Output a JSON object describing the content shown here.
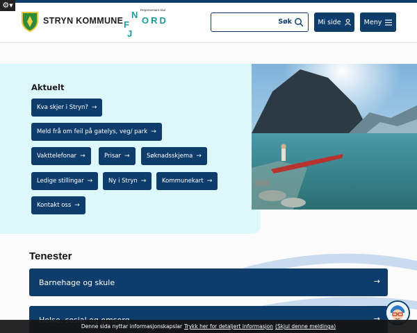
{
  "colors": {
    "primary": "#0f3d6b",
    "accent": "#1b9aa0",
    "hero_bg": "#ddf8fb"
  },
  "tools": {
    "gear_icon": "gear-icon"
  },
  "header": {
    "brand": "STRYN KOMMUNE",
    "partner_tag": "Representant skul",
    "partner_letters": {
      "n": "N",
      "ord": "ORD",
      "f": "F",
      "j": "J"
    },
    "search_label": "Søk",
    "search_value": "",
    "mi_side": "Mi side",
    "meny": "Meny"
  },
  "aktuelt": {
    "title": "Aktuelt",
    "links": [
      "Kva skjer i Stryn?",
      "Meld frå om feil på gatelys, veg/ park",
      "Vakttelefonar",
      "Prisar",
      "Søknadsskjema",
      "Ledige stillingar",
      "Ny i Stryn",
      "Kommunekart",
      "Kontakt oss"
    ],
    "arrow": "→"
  },
  "tenester": {
    "title": "Tenester",
    "items": [
      "Barnehage og skule",
      "Helse, sosial og omsorg"
    ],
    "arrow": "→"
  },
  "cookie": {
    "text": "Denne sida nyttar informasjonskapslar",
    "link_details": "Trykk her for detaljert informasjon",
    "link_hide": "(Skjul denne meldinga)"
  }
}
